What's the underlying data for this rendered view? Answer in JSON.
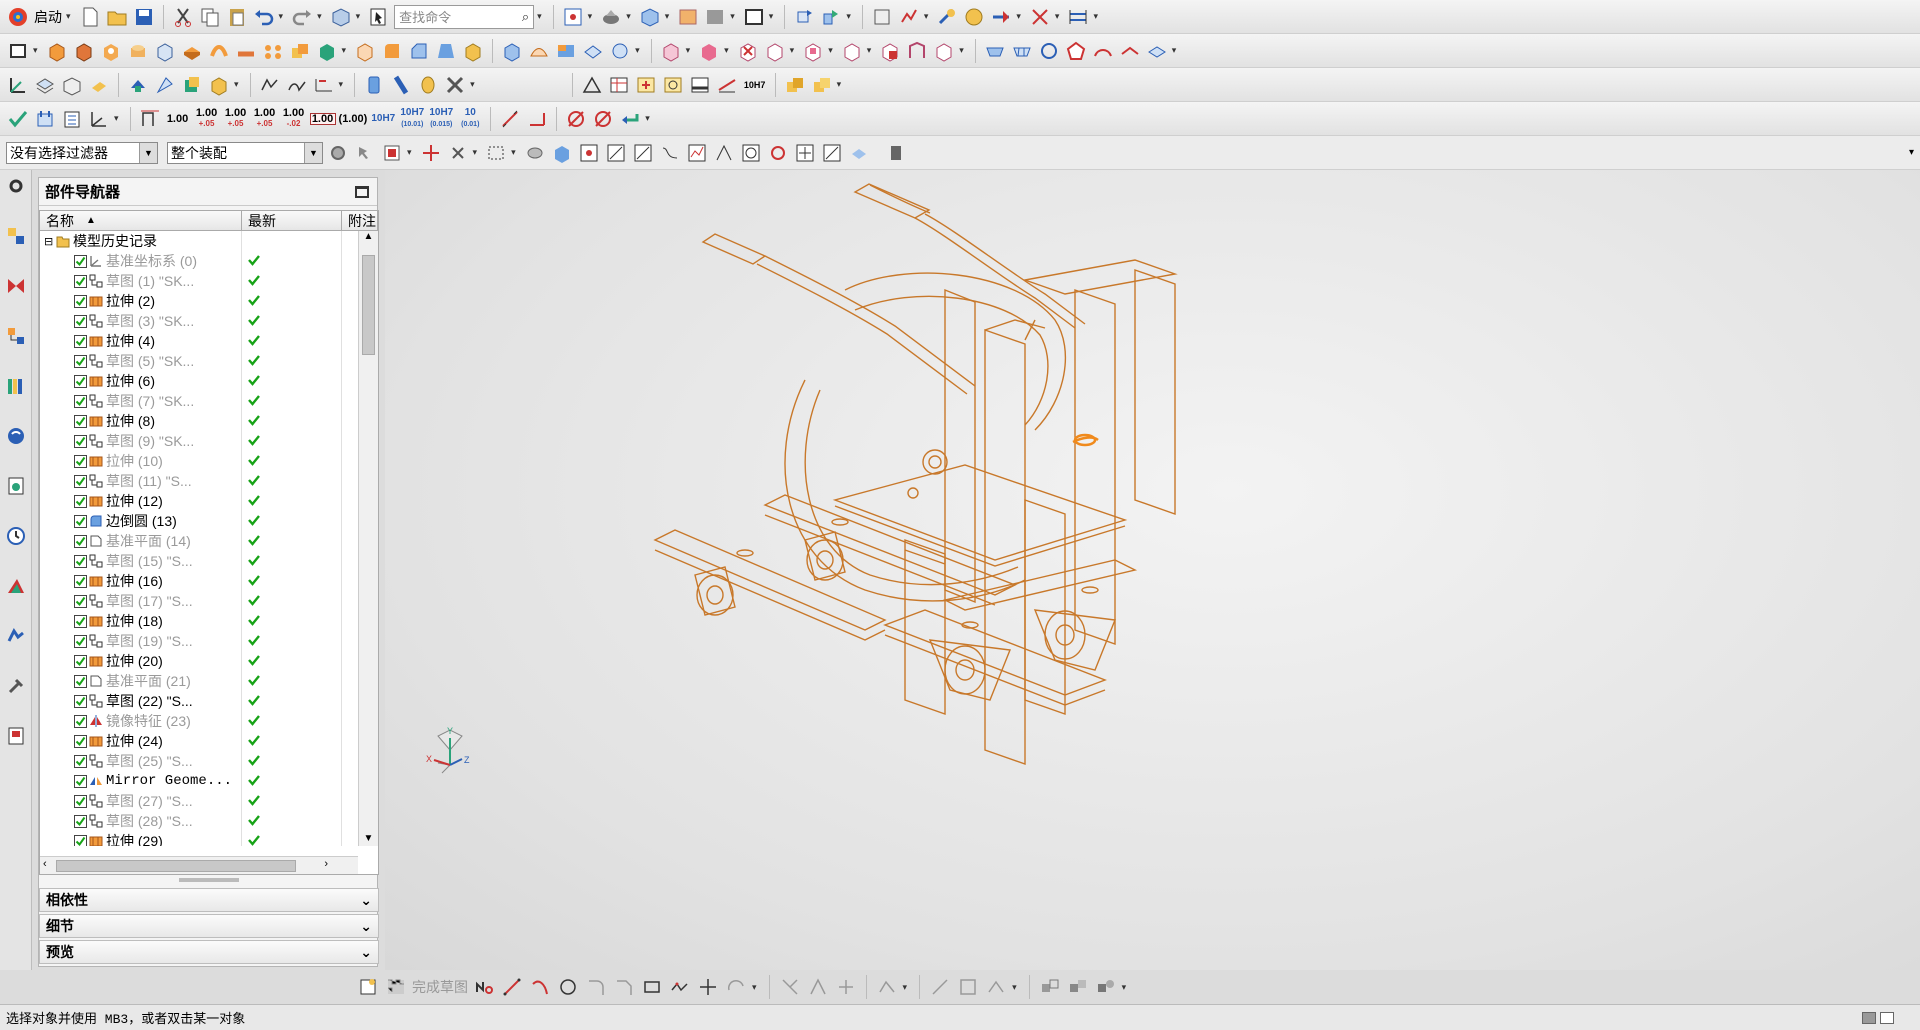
{
  "toolbar1": {
    "start_label": "启动",
    "search_placeholder": "查找命令"
  },
  "toolbar4": {
    "tol_1": "1.00",
    "tol_2_top": "1.00",
    "tol_2_bot": "+.05",
    "tol_3_top": "1.00",
    "tol_3_bot": "+.05",
    "tol_4_top": "1.00",
    "tol_4_bot": "+.05",
    "tol_5_top": "1.00",
    "tol_5_bot": "-.02",
    "tol_6": "1.00",
    "tol_7": "(1.00)",
    "fit_1": "10H7",
    "fit_2_top": "10H7",
    "fit_2_bot": "(10.01)",
    "fit_3_top": "10H7",
    "fit_3_bot": "(0.015)",
    "fit_4_top": "10",
    "fit_4_bot": "(0.01)",
    "fit_5": "10H7"
  },
  "filterbar": {
    "selection_filter": "没有选择过滤器",
    "assembly_scope": "整个装配"
  },
  "navigator": {
    "title": "部件导航器",
    "columns": [
      "名称",
      "最新",
      "附注"
    ],
    "root_label": "模型历史记录",
    "features": [
      {
        "label": "基准坐标系 (0)",
        "dim": true,
        "icon": "datum-csys-icon"
      },
      {
        "label": "草图 (1) \"SK...",
        "dim": true,
        "icon": "sketch-icon"
      },
      {
        "label": "拉伸 (2)",
        "dim": false,
        "icon": "extrude-icon"
      },
      {
        "label": "草图 (3) \"SK...",
        "dim": true,
        "icon": "sketch-icon"
      },
      {
        "label": "拉伸 (4)",
        "dim": false,
        "icon": "extrude-icon"
      },
      {
        "label": "草图 (5) \"SK...",
        "dim": true,
        "icon": "sketch-icon"
      },
      {
        "label": "拉伸 (6)",
        "dim": false,
        "icon": "extrude-icon"
      },
      {
        "label": "草图 (7) \"SK...",
        "dim": true,
        "icon": "sketch-icon"
      },
      {
        "label": "拉伸 (8)",
        "dim": false,
        "icon": "extrude-icon"
      },
      {
        "label": "草图 (9) \"SK...",
        "dim": true,
        "icon": "sketch-icon"
      },
      {
        "label": "拉伸 (10)",
        "dim": true,
        "icon": "extrude-icon"
      },
      {
        "label": "草图 (11) \"S...",
        "dim": true,
        "icon": "sketch-icon"
      },
      {
        "label": "拉伸 (12)",
        "dim": false,
        "icon": "extrude-icon"
      },
      {
        "label": "边倒圆 (13)",
        "dim": false,
        "icon": "edge-blend-icon"
      },
      {
        "label": "基准平面 (14)",
        "dim": true,
        "icon": "datum-plane-icon"
      },
      {
        "label": "草图 (15) \"S...",
        "dim": true,
        "icon": "sketch-icon"
      },
      {
        "label": "拉伸 (16)",
        "dim": false,
        "icon": "extrude-icon"
      },
      {
        "label": "草图 (17) \"S...",
        "dim": true,
        "icon": "sketch-icon"
      },
      {
        "label": "拉伸 (18)",
        "dim": false,
        "icon": "extrude-icon"
      },
      {
        "label": "草图 (19) \"S...",
        "dim": true,
        "icon": "sketch-icon"
      },
      {
        "label": "拉伸 (20)",
        "dim": false,
        "icon": "extrude-icon"
      },
      {
        "label": "基准平面 (21)",
        "dim": true,
        "icon": "datum-plane-icon"
      },
      {
        "label": "草图 (22) \"S...",
        "dim": false,
        "icon": "sketch-icon"
      },
      {
        "label": "镜像特征 (23)",
        "dim": true,
        "icon": "mirror-feature-icon"
      },
      {
        "label": "拉伸 (24)",
        "dim": false,
        "icon": "extrude-icon"
      },
      {
        "label": "草图 (25) \"S...",
        "dim": true,
        "icon": "sketch-icon"
      },
      {
        "label": "Mirror Geome...",
        "dim": false,
        "icon": "mirror-geometry-icon"
      },
      {
        "label": "草图 (27) \"S...",
        "dim": true,
        "icon": "sketch-icon"
      },
      {
        "label": "草图 (28) \"S...",
        "dim": true,
        "icon": "sketch-icon"
      },
      {
        "label": "拉伸 (29)",
        "dim": false,
        "icon": "extrude-icon"
      }
    ],
    "panels": {
      "dependencies": "相依性",
      "details": "细节",
      "preview": "预览"
    }
  },
  "sketchbar": {
    "finish_sketch": "完成草图"
  },
  "status": {
    "prompt": "选择对象并使用 MB3，或者双击某一对象"
  },
  "colors": {
    "model_wire": "#c8782a",
    "model_highlight": "#f08a1c",
    "check_green": "#17a317"
  },
  "triad": {
    "x": "X",
    "y": "Y",
    "z": "Z"
  }
}
